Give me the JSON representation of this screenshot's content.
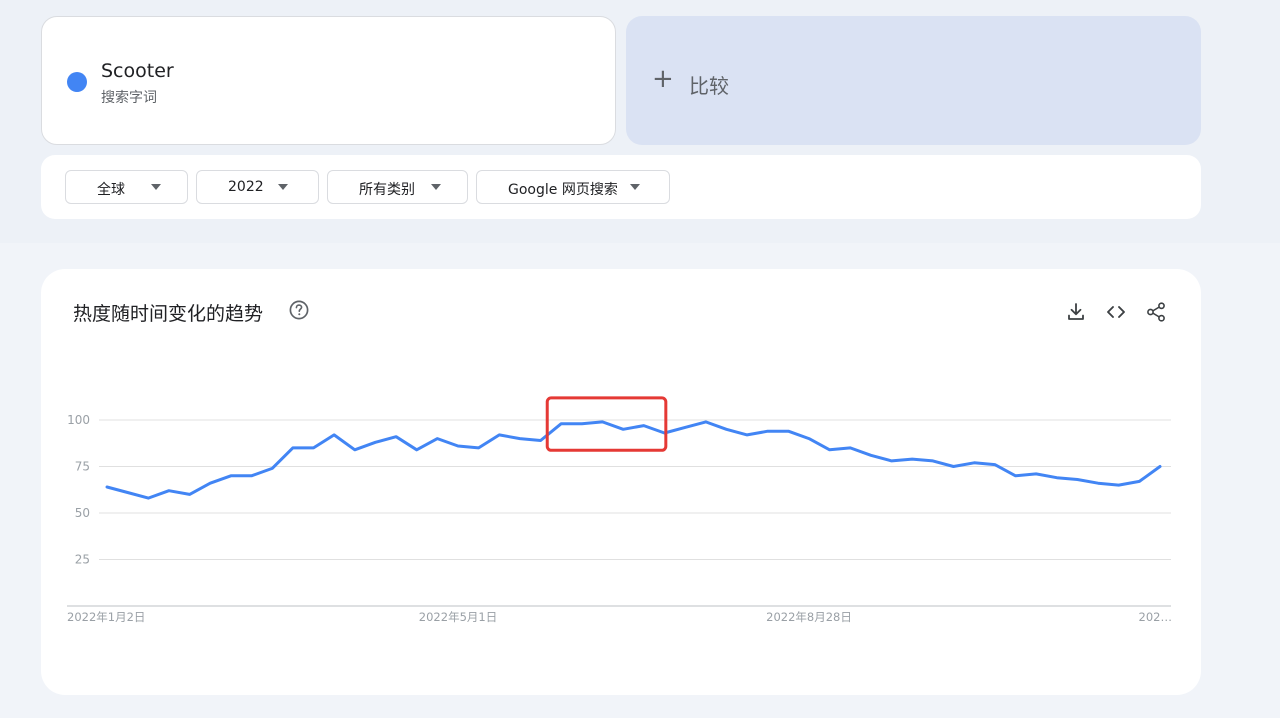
{
  "term": {
    "name": "Scooter",
    "type": "搜索字词",
    "color": "#4285f4"
  },
  "compare": {
    "icon": "plus-icon",
    "label": "比较"
  },
  "filters": {
    "region": "全球",
    "time": "2022",
    "category": "所有类别",
    "property": "Google 网页搜索"
  },
  "chart_card": {
    "title": "热度随时间变化的趋势",
    "help_icon": "help-circle-icon",
    "actions": [
      "download-icon",
      "embed-code-icon",
      "share-icon"
    ]
  },
  "chart_data": {
    "type": "line",
    "title": "",
    "xlabel": "",
    "ylabel": "",
    "ylim": [
      0,
      100
    ],
    "yticks": [
      25,
      50,
      75,
      100
    ],
    "grid": true,
    "line_color": "#4285f4",
    "highlight_color": "#e53935",
    "x_tick_labels": [
      "2022年1月2日",
      "2022年5月1日",
      "2022年8月28日",
      "202…"
    ],
    "x_tick_indices": [
      0,
      17,
      34,
      51
    ],
    "highlight_range": [
      22,
      26
    ],
    "series": [
      {
        "values": [
          64,
          61,
          58,
          62,
          60,
          66,
          70,
          70,
          74,
          85,
          85,
          92,
          84,
          88,
          91,
          84,
          90,
          86,
          85,
          92,
          90,
          89,
          98,
          98,
          99,
          95,
          97,
          93,
          96,
          99,
          95,
          92,
          94,
          94,
          90,
          84,
          85,
          81,
          78,
          79,
          78,
          75,
          77,
          76,
          70,
          71,
          69,
          68,
          66,
          65,
          67,
          75
        ]
      }
    ]
  }
}
